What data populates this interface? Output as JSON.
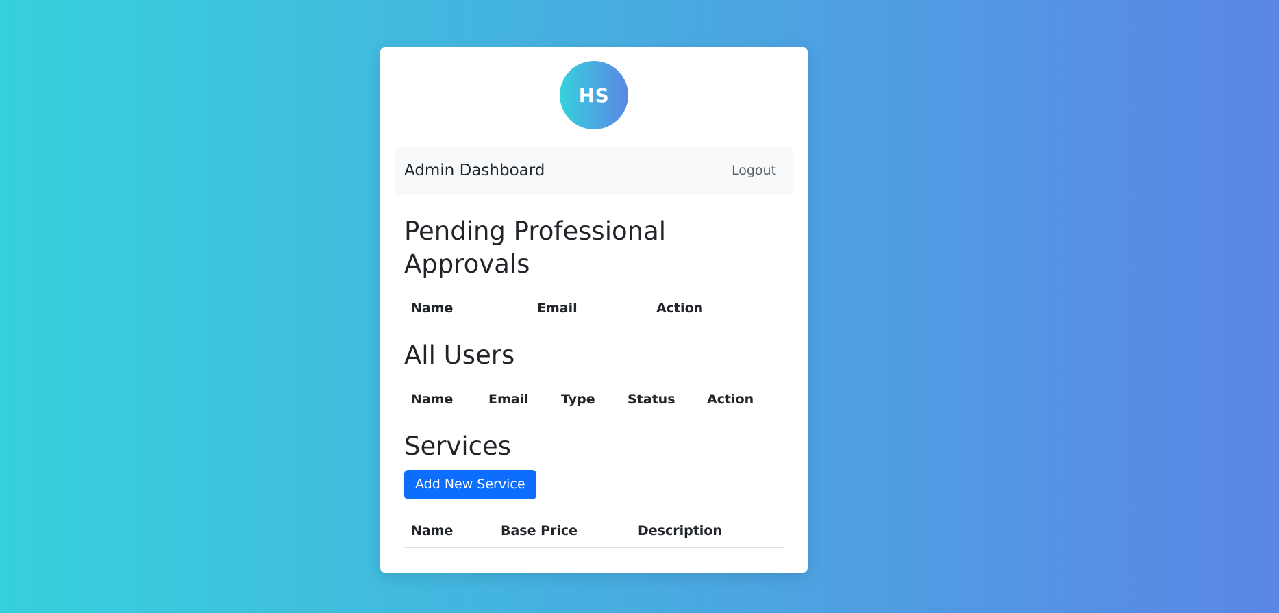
{
  "avatar": {
    "initials": "HS"
  },
  "navbar": {
    "brand": "Admin Dashboard",
    "logout_label": "Logout"
  },
  "pending": {
    "title": "Pending Professional Approvals",
    "columns": [
      "Name",
      "Email",
      "Action"
    ]
  },
  "users": {
    "title": "All Users",
    "columns": [
      "Name",
      "Email",
      "Type",
      "Status",
      "Action"
    ]
  },
  "services": {
    "title": "Services",
    "add_button_label": "Add New Service",
    "columns": [
      "Name",
      "Base Price",
      "Description"
    ]
  },
  "colors": {
    "gradient_start": "#36d1dc",
    "gradient_end": "#5b86e5",
    "primary_button": "#0d6efd",
    "navbar_bg": "#f8f9fa"
  }
}
